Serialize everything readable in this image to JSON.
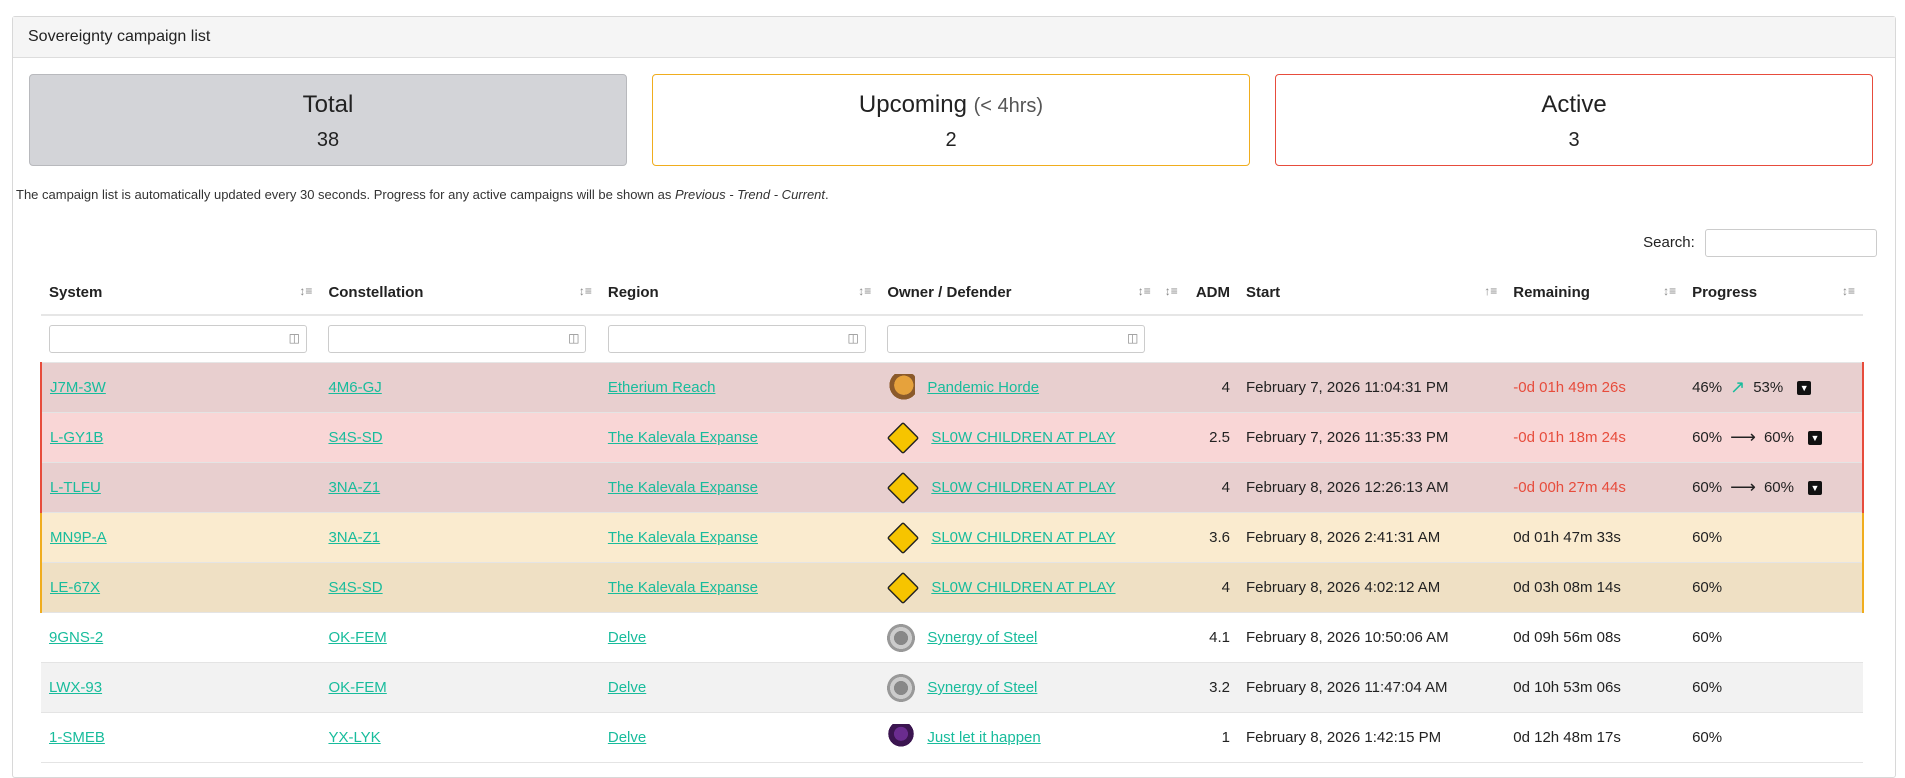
{
  "panel": {
    "title": "Sovereignty campaign list"
  },
  "cards": {
    "total": {
      "title": "Total",
      "value": "38"
    },
    "upcoming": {
      "title": "Upcoming",
      "sub": "(< 4hrs)",
      "value": "2"
    },
    "active": {
      "title": "Active",
      "value": "3"
    }
  },
  "note": {
    "prefix": "The campaign list is automatically updated every 30 seconds. Progress for any active campaigns will be shown as ",
    "emphasis": "Previous - Trend - Current",
    "suffix": "."
  },
  "search": {
    "label": "Search:",
    "value": ""
  },
  "table": {
    "columns": {
      "system": "System",
      "constellation": "Constellation",
      "region": "Region",
      "owner": "Owner / Defender",
      "adm": "ADM",
      "start": "Start",
      "remaining": "Remaining",
      "progress": "Progress"
    },
    "rows": [
      {
        "system": "J7M-3W",
        "constellation": "4M6-GJ",
        "region": "Etherium Reach",
        "owner": "Pandemic Horde",
        "adm": "4",
        "start": "February 7, 2026 11:04:31 PM",
        "remaining": "-0d 01h 49m 26s",
        "prev": "46%",
        "cur": "53%"
      },
      {
        "system": "L-GY1B",
        "constellation": "S4S-SD",
        "region": "The Kalevala Expanse",
        "owner": "SL0W CHILDREN AT PLAY",
        "adm": "2.5",
        "start": "February 7, 2026 11:35:33 PM",
        "remaining": "-0d 01h 18m 24s",
        "prev": "60%",
        "cur": "60%"
      },
      {
        "system": "L-TLFU",
        "constellation": "3NA-Z1",
        "region": "The Kalevala Expanse",
        "owner": "SL0W CHILDREN AT PLAY",
        "adm": "4",
        "start": "February 8, 2026 12:26:13 AM",
        "remaining": "-0d 00h 27m 44s",
        "prev": "60%",
        "cur": "60%"
      },
      {
        "system": "MN9P-A",
        "constellation": "3NA-Z1",
        "region": "The Kalevala Expanse",
        "owner": "SL0W CHILDREN AT PLAY",
        "adm": "3.6",
        "start": "February 8, 2026 2:41:31 AM",
        "remaining": "0d 01h 47m 33s",
        "cur": "60%"
      },
      {
        "system": "LE-67X",
        "constellation": "S4S-SD",
        "region": "The Kalevala Expanse",
        "owner": "SL0W CHILDREN AT PLAY",
        "adm": "4",
        "start": "February 8, 2026 4:02:12 AM",
        "remaining": "0d 03h 08m 14s",
        "cur": "60%"
      },
      {
        "system": "9GNS-2",
        "constellation": "OK-FEM",
        "region": "Delve",
        "owner": "Synergy of Steel",
        "adm": "4.1",
        "start": "February 8, 2026 10:50:06 AM",
        "remaining": "0d 09h 56m 08s",
        "cur": "60%"
      },
      {
        "system": "LWX-93",
        "constellation": "OK-FEM",
        "region": "Delve",
        "owner": "Synergy of Steel",
        "adm": "3.2",
        "start": "February 8, 2026 11:47:04 AM",
        "remaining": "0d 10h 53m 06s",
        "cur": "60%"
      },
      {
        "system": "1-SMEB",
        "constellation": "YX-LYK",
        "region": "Delve",
        "owner": "Just let it happen",
        "adm": "1",
        "start": "February 8, 2026 1:42:15 PM",
        "remaining": "0d 12h 48m 17s",
        "cur": "60%"
      }
    ]
  },
  "colors": {
    "link": "#18bc9c",
    "active_border": "#e74c3c",
    "upcoming_border": "#f0ad1e",
    "negative_text": "#e74c3c"
  }
}
